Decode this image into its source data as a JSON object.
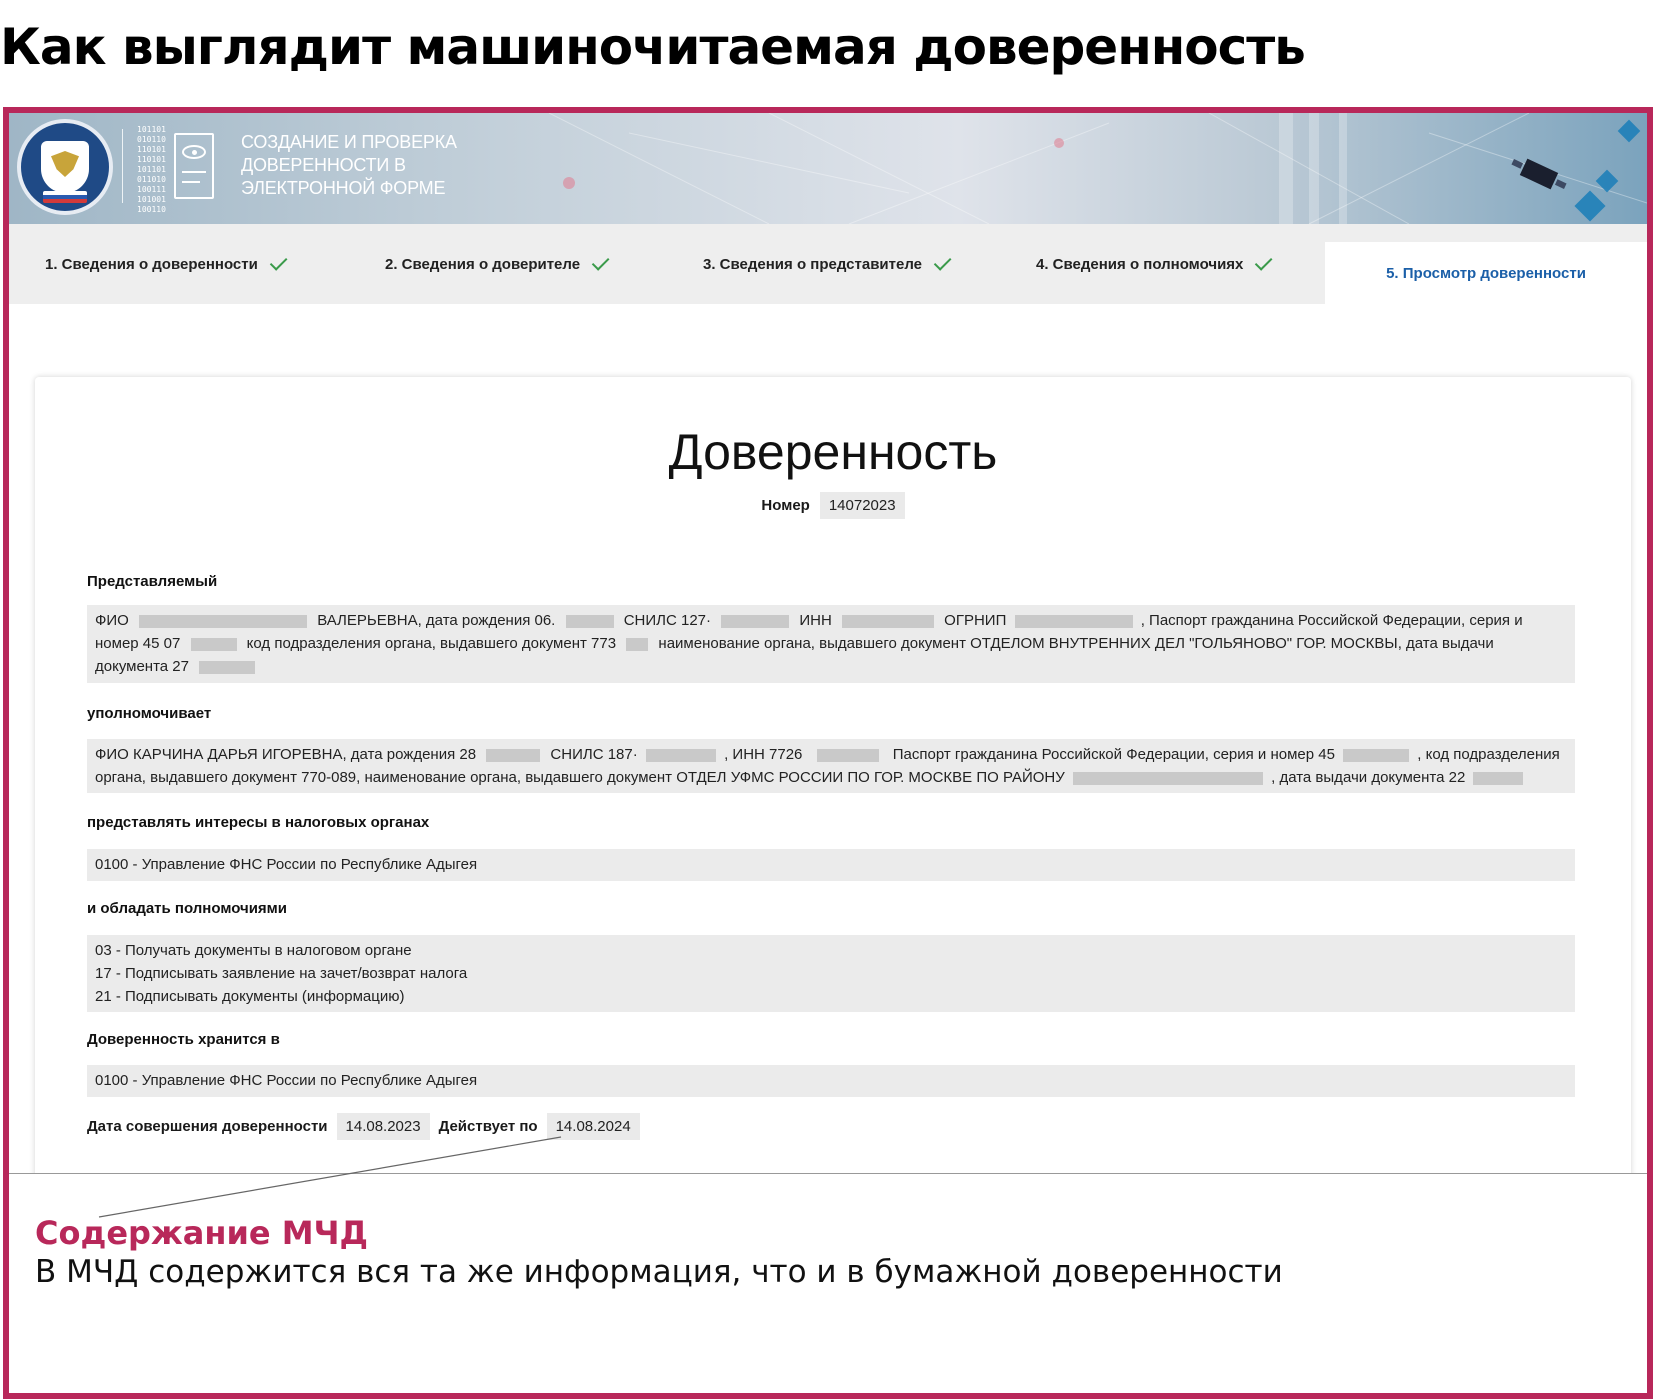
{
  "headline": "Как выглядит машиночитаемая доверенность",
  "banner": {
    "title": "СОЗДАНИЕ И ПРОВЕРКА ДОВЕРЕННОСТИ В ЭЛЕКТРОННОЙ ФОРМЕ",
    "binary": "101101 010110 110101 110101 101101 011010 100111 101001 100110"
  },
  "steps": [
    {
      "label": "1. Сведения о доверенности",
      "done": true
    },
    {
      "label": "2. Сведения о доверителе",
      "done": true
    },
    {
      "label": "3. Сведения о представителе",
      "done": true
    },
    {
      "label": "4. Сведения о полномочиях",
      "done": true
    },
    {
      "label": "5. Просмотр доверенности",
      "active": true
    }
  ],
  "document": {
    "title": "Доверенность",
    "number_label": "Номер",
    "number_value": "14072023",
    "principal_label": "Представляемый",
    "principal": {
      "fio": "ФИО",
      "name_suffix": "ВАЛЕРЬЕВНА, дата рождения 06.",
      "snils": "СНИЛС 127·",
      "inn": "ИНН",
      "ogrnip": "ОГРНИП",
      "passport_a": ", Паспорт гражданина Российской Федерации, серия и",
      "passport_b": "номер 45 07",
      "dept_code": "код подразделения органа, выдавшего документ 773",
      "dept_name": "наименование органа, выдавшего документ ОТДЕЛОМ ВНУТРЕННИХ ДЕЛ \"ГОЛЬЯНОВО\" ГОР. МОСКВЫ, дата выдачи",
      "issue_date": "документа 27"
    },
    "authorizes_label": "уполномочивает",
    "representative": {
      "fio": "ФИО КАРЧИНА ДАРЬЯ ИГОРЕВНА, дата рождения 28",
      "snils": "СНИЛС 187·",
      "inn": ", ИНН 7726",
      "passport": "Паспорт гражданина Российской Федерации, серия и номер 45",
      "dept_code": ", код подразделения",
      "line2": "органа, выдавшего документ 770-089, наименование органа, выдавшего документ ОТДЕЛ УФМС РОССИИ ПО ГОР. МОСКВЕ ПО РАЙОНУ",
      "issue_date": ", дата выдачи документа 22"
    },
    "interests_label": "представлять интересы в налоговых органах",
    "interests_value": "0100 - Управление ФНС России по Республике Адыгея",
    "powers_label": "и обладать полномочиями",
    "powers": [
      "03 - Получать документы в налоговом органе",
      "17 - Подписывать заявление на зачет/возврат налога",
      "21 - Подписывать документы (информацию)"
    ],
    "stored_label": "Доверенность хранится в",
    "stored_value": "0100 - Управление ФНС России по Республике Адыгея",
    "date_label": "Дата совершения доверенности",
    "date_value": "14.08.2023",
    "valid_label": "Действует по",
    "valid_value": "14.08.2024"
  },
  "caption": {
    "title": "Содержание МЧД",
    "text": "В МЧД содержится вся та же информация, что и в бумажной доверенности"
  },
  "colors": {
    "frame": "#b8285a",
    "active_step": "#1b5fa8",
    "check": "#3a9a4a"
  }
}
